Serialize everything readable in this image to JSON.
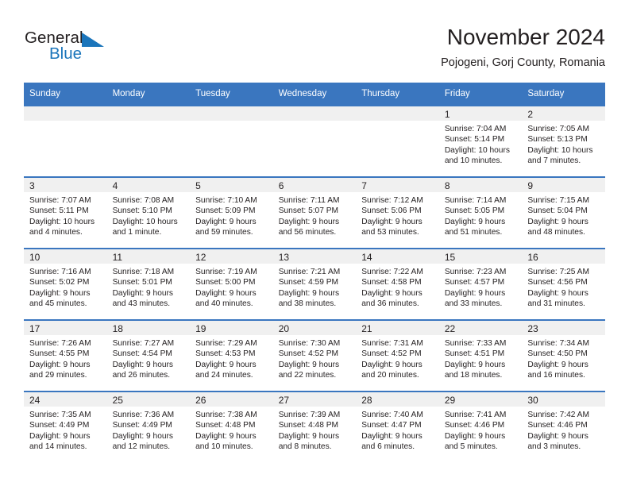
{
  "brand": {
    "name_part1": "General",
    "name_part2": "Blue",
    "logo_icon": "triangle-icon",
    "accent_color": "#1b75bb"
  },
  "header": {
    "month_title": "November 2024",
    "location": "Pojogeni, Gorj County, Romania"
  },
  "theme": {
    "header_blue": "#3a76bf",
    "daynum_band": "#f0f0f0",
    "text": "#231f20"
  },
  "calendar": {
    "weekday_headers": [
      "Sunday",
      "Monday",
      "Tuesday",
      "Wednesday",
      "Thursday",
      "Friday",
      "Saturday"
    ],
    "weeks": [
      [
        {
          "day": "",
          "sunrise": "",
          "sunset": "",
          "daylight": ""
        },
        {
          "day": "",
          "sunrise": "",
          "sunset": "",
          "daylight": ""
        },
        {
          "day": "",
          "sunrise": "",
          "sunset": "",
          "daylight": ""
        },
        {
          "day": "",
          "sunrise": "",
          "sunset": "",
          "daylight": ""
        },
        {
          "day": "",
          "sunrise": "",
          "sunset": "",
          "daylight": ""
        },
        {
          "day": "1",
          "sunrise": "Sunrise: 7:04 AM",
          "sunset": "Sunset: 5:14 PM",
          "daylight": "Daylight: 10 hours and 10 minutes."
        },
        {
          "day": "2",
          "sunrise": "Sunrise: 7:05 AM",
          "sunset": "Sunset: 5:13 PM",
          "daylight": "Daylight: 10 hours and 7 minutes."
        }
      ],
      [
        {
          "day": "3",
          "sunrise": "Sunrise: 7:07 AM",
          "sunset": "Sunset: 5:11 PM",
          "daylight": "Daylight: 10 hours and 4 minutes."
        },
        {
          "day": "4",
          "sunrise": "Sunrise: 7:08 AM",
          "sunset": "Sunset: 5:10 PM",
          "daylight": "Daylight: 10 hours and 1 minute."
        },
        {
          "day": "5",
          "sunrise": "Sunrise: 7:10 AM",
          "sunset": "Sunset: 5:09 PM",
          "daylight": "Daylight: 9 hours and 59 minutes."
        },
        {
          "day": "6",
          "sunrise": "Sunrise: 7:11 AM",
          "sunset": "Sunset: 5:07 PM",
          "daylight": "Daylight: 9 hours and 56 minutes."
        },
        {
          "day": "7",
          "sunrise": "Sunrise: 7:12 AM",
          "sunset": "Sunset: 5:06 PM",
          "daylight": "Daylight: 9 hours and 53 minutes."
        },
        {
          "day": "8",
          "sunrise": "Sunrise: 7:14 AM",
          "sunset": "Sunset: 5:05 PM",
          "daylight": "Daylight: 9 hours and 51 minutes."
        },
        {
          "day": "9",
          "sunrise": "Sunrise: 7:15 AM",
          "sunset": "Sunset: 5:04 PM",
          "daylight": "Daylight: 9 hours and 48 minutes."
        }
      ],
      [
        {
          "day": "10",
          "sunrise": "Sunrise: 7:16 AM",
          "sunset": "Sunset: 5:02 PM",
          "daylight": "Daylight: 9 hours and 45 minutes."
        },
        {
          "day": "11",
          "sunrise": "Sunrise: 7:18 AM",
          "sunset": "Sunset: 5:01 PM",
          "daylight": "Daylight: 9 hours and 43 minutes."
        },
        {
          "day": "12",
          "sunrise": "Sunrise: 7:19 AM",
          "sunset": "Sunset: 5:00 PM",
          "daylight": "Daylight: 9 hours and 40 minutes."
        },
        {
          "day": "13",
          "sunrise": "Sunrise: 7:21 AM",
          "sunset": "Sunset: 4:59 PM",
          "daylight": "Daylight: 9 hours and 38 minutes."
        },
        {
          "day": "14",
          "sunrise": "Sunrise: 7:22 AM",
          "sunset": "Sunset: 4:58 PM",
          "daylight": "Daylight: 9 hours and 36 minutes."
        },
        {
          "day": "15",
          "sunrise": "Sunrise: 7:23 AM",
          "sunset": "Sunset: 4:57 PM",
          "daylight": "Daylight: 9 hours and 33 minutes."
        },
        {
          "day": "16",
          "sunrise": "Sunrise: 7:25 AM",
          "sunset": "Sunset: 4:56 PM",
          "daylight": "Daylight: 9 hours and 31 minutes."
        }
      ],
      [
        {
          "day": "17",
          "sunrise": "Sunrise: 7:26 AM",
          "sunset": "Sunset: 4:55 PM",
          "daylight": "Daylight: 9 hours and 29 minutes."
        },
        {
          "day": "18",
          "sunrise": "Sunrise: 7:27 AM",
          "sunset": "Sunset: 4:54 PM",
          "daylight": "Daylight: 9 hours and 26 minutes."
        },
        {
          "day": "19",
          "sunrise": "Sunrise: 7:29 AM",
          "sunset": "Sunset: 4:53 PM",
          "daylight": "Daylight: 9 hours and 24 minutes."
        },
        {
          "day": "20",
          "sunrise": "Sunrise: 7:30 AM",
          "sunset": "Sunset: 4:52 PM",
          "daylight": "Daylight: 9 hours and 22 minutes."
        },
        {
          "day": "21",
          "sunrise": "Sunrise: 7:31 AM",
          "sunset": "Sunset: 4:52 PM",
          "daylight": "Daylight: 9 hours and 20 minutes."
        },
        {
          "day": "22",
          "sunrise": "Sunrise: 7:33 AM",
          "sunset": "Sunset: 4:51 PM",
          "daylight": "Daylight: 9 hours and 18 minutes."
        },
        {
          "day": "23",
          "sunrise": "Sunrise: 7:34 AM",
          "sunset": "Sunset: 4:50 PM",
          "daylight": "Daylight: 9 hours and 16 minutes."
        }
      ],
      [
        {
          "day": "24",
          "sunrise": "Sunrise: 7:35 AM",
          "sunset": "Sunset: 4:49 PM",
          "daylight": "Daylight: 9 hours and 14 minutes."
        },
        {
          "day": "25",
          "sunrise": "Sunrise: 7:36 AM",
          "sunset": "Sunset: 4:49 PM",
          "daylight": "Daylight: 9 hours and 12 minutes."
        },
        {
          "day": "26",
          "sunrise": "Sunrise: 7:38 AM",
          "sunset": "Sunset: 4:48 PM",
          "daylight": "Daylight: 9 hours and 10 minutes."
        },
        {
          "day": "27",
          "sunrise": "Sunrise: 7:39 AM",
          "sunset": "Sunset: 4:48 PM",
          "daylight": "Daylight: 9 hours and 8 minutes."
        },
        {
          "day": "28",
          "sunrise": "Sunrise: 7:40 AM",
          "sunset": "Sunset: 4:47 PM",
          "daylight": "Daylight: 9 hours and 6 minutes."
        },
        {
          "day": "29",
          "sunrise": "Sunrise: 7:41 AM",
          "sunset": "Sunset: 4:46 PM",
          "daylight": "Daylight: 9 hours and 5 minutes."
        },
        {
          "day": "30",
          "sunrise": "Sunrise: 7:42 AM",
          "sunset": "Sunset: 4:46 PM",
          "daylight": "Daylight: 9 hours and 3 minutes."
        }
      ]
    ]
  }
}
